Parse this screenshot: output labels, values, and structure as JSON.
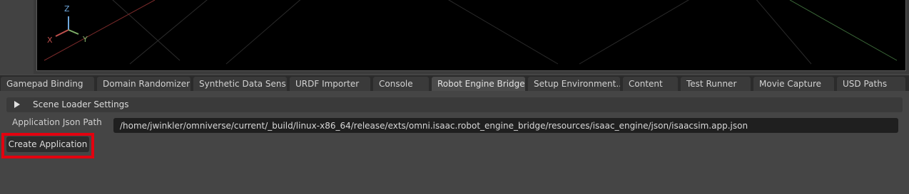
{
  "viewport": {
    "axes": {
      "z": "Z",
      "x": "X",
      "y": "Y"
    }
  },
  "tabs": [
    {
      "label": "Gamepad Binding",
      "active": false
    },
    {
      "label": "Domain Randomizer",
      "active": false
    },
    {
      "label": "Synthetic Data Sens...",
      "active": false
    },
    {
      "label": "URDF Importer",
      "active": false
    },
    {
      "label": "Console",
      "active": false
    },
    {
      "label": "Robot Engine Bridge",
      "active": true
    },
    {
      "label": "Setup Environment...",
      "active": false
    },
    {
      "label": "Content",
      "active": false
    },
    {
      "label": "Test Runner",
      "active": false
    },
    {
      "label": "Movie Capture",
      "active": false
    },
    {
      "label": "USD Paths",
      "active": false
    }
  ],
  "panel": {
    "scene_loader_label": "Scene Loader Settings",
    "app_json_label": "Application Json Path",
    "app_json_value": "/home/jwinkler/omniverse/current/_build/linux-x86_64/release/exts/omni.isaac.robot_engine_bridge/resources/isaac_engine/json/isaacsim.app.json",
    "create_button_label": "Create Application"
  },
  "colors": {
    "highlight": "#e3000f",
    "axis_x": "#c0504d",
    "axis_y": "#7fb069",
    "axis_z": "#6fa8dc"
  }
}
